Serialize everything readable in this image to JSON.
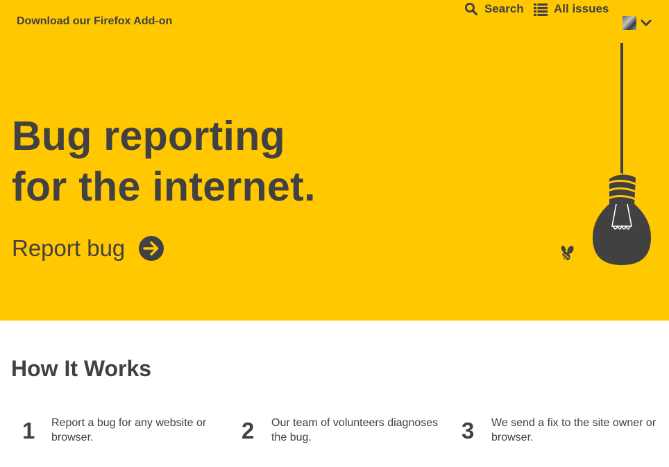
{
  "header": {
    "addon_link": "Download our Firefox Add-on",
    "nav": {
      "search": "Search",
      "all_issues": "All issues"
    }
  },
  "hero": {
    "headline_line1": "Bug reporting",
    "headline_line2": "for the internet.",
    "cta": "Report bug"
  },
  "how_it_works": {
    "title": "How It Works",
    "steps": [
      {
        "number": "1",
        "text": "Report a bug for any website or browser."
      },
      {
        "number": "2",
        "text": "Our team of volunteers diagnoses the bug."
      },
      {
        "number": "3",
        "text": "We send a fix to the site owner or browser."
      }
    ]
  },
  "icons": {
    "search": "search-icon",
    "list": "list-icon",
    "chevron": "chevron-down-icon",
    "arrow": "arrow-right-circle-icon",
    "bulb": "lightbulb-illustration",
    "bee": "bee-icon"
  },
  "colors": {
    "hero_bg": "#ffc800",
    "text": "#414042",
    "page_bg": "#ffffff"
  }
}
